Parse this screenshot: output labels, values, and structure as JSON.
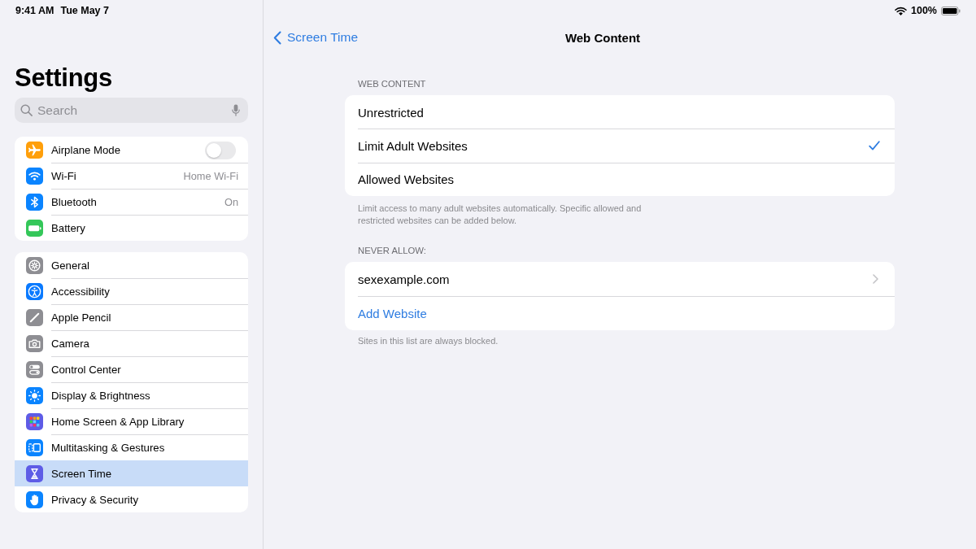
{
  "status_bar": {
    "time": "9:41 AM",
    "date": "Tue May 7",
    "battery": "100%"
  },
  "sidebar": {
    "title": "Settings",
    "search": {
      "placeholder": "Search"
    },
    "groups": [
      {
        "items": [
          {
            "label": "Airplane Mode",
            "kind": "toggle",
            "on": false,
            "selected": false,
            "color": "#ff9f0a"
          },
          {
            "label": "Wi-Fi",
            "kind": "value",
            "value": "Home Wi-Fi",
            "selected": false,
            "color": "#0a84ff"
          },
          {
            "label": "Bluetooth",
            "kind": "value",
            "value": "On",
            "selected": false,
            "color": "#0a84ff"
          },
          {
            "label": "Battery",
            "kind": "plain",
            "selected": false,
            "color": "#34c759"
          }
        ]
      },
      {
        "items": [
          {
            "label": "General",
            "kind": "plain",
            "selected": false,
            "color": "#8e8e93"
          },
          {
            "label": "Accessibility",
            "kind": "plain",
            "selected": false,
            "color": "#0a7aff"
          },
          {
            "label": "Apple Pencil",
            "kind": "plain",
            "selected": false,
            "color": "#8e8e93"
          },
          {
            "label": "Camera",
            "kind": "plain",
            "selected": false,
            "color": "#8e8e93"
          },
          {
            "label": "Control Center",
            "kind": "plain",
            "selected": false,
            "color": "#8e8e93"
          },
          {
            "label": "Display & Brightness",
            "kind": "plain",
            "selected": false,
            "color": "#0a84ff"
          },
          {
            "label": "Home Screen & App Library",
            "kind": "plain",
            "selected": false,
            "color": "#5e5ce6"
          },
          {
            "label": "Multitasking & Gestures",
            "kind": "plain",
            "selected": false,
            "color": "#0a84ff"
          },
          {
            "label": "Screen Time",
            "kind": "plain",
            "selected": true,
            "color": "#5e5ce6"
          },
          {
            "label": "Privacy & Security",
            "kind": "plain",
            "selected": false,
            "color": "#0a84ff"
          }
        ]
      }
    ]
  },
  "nav": {
    "back": "Screen Time",
    "title": "Web Content"
  },
  "sections": [
    {
      "header": "WEB CONTENT",
      "rows": [
        {
          "label": "Unrestricted",
          "kind": "option",
          "selected": false
        },
        {
          "label": "Limit Adult Websites",
          "kind": "option",
          "selected": true
        },
        {
          "label": "Allowed Websites",
          "kind": "option",
          "selected": false
        }
      ],
      "footer": "Limit access to many adult websites automatically. Specific allowed and restricted websites can be added below."
    },
    {
      "header": "NEVER ALLOW:",
      "rows": [
        {
          "label": "sexexample.com",
          "kind": "disclosure"
        },
        {
          "label": "Add Website",
          "kind": "action"
        }
      ],
      "footer": "Sites in this list are always blocked."
    }
  ]
}
